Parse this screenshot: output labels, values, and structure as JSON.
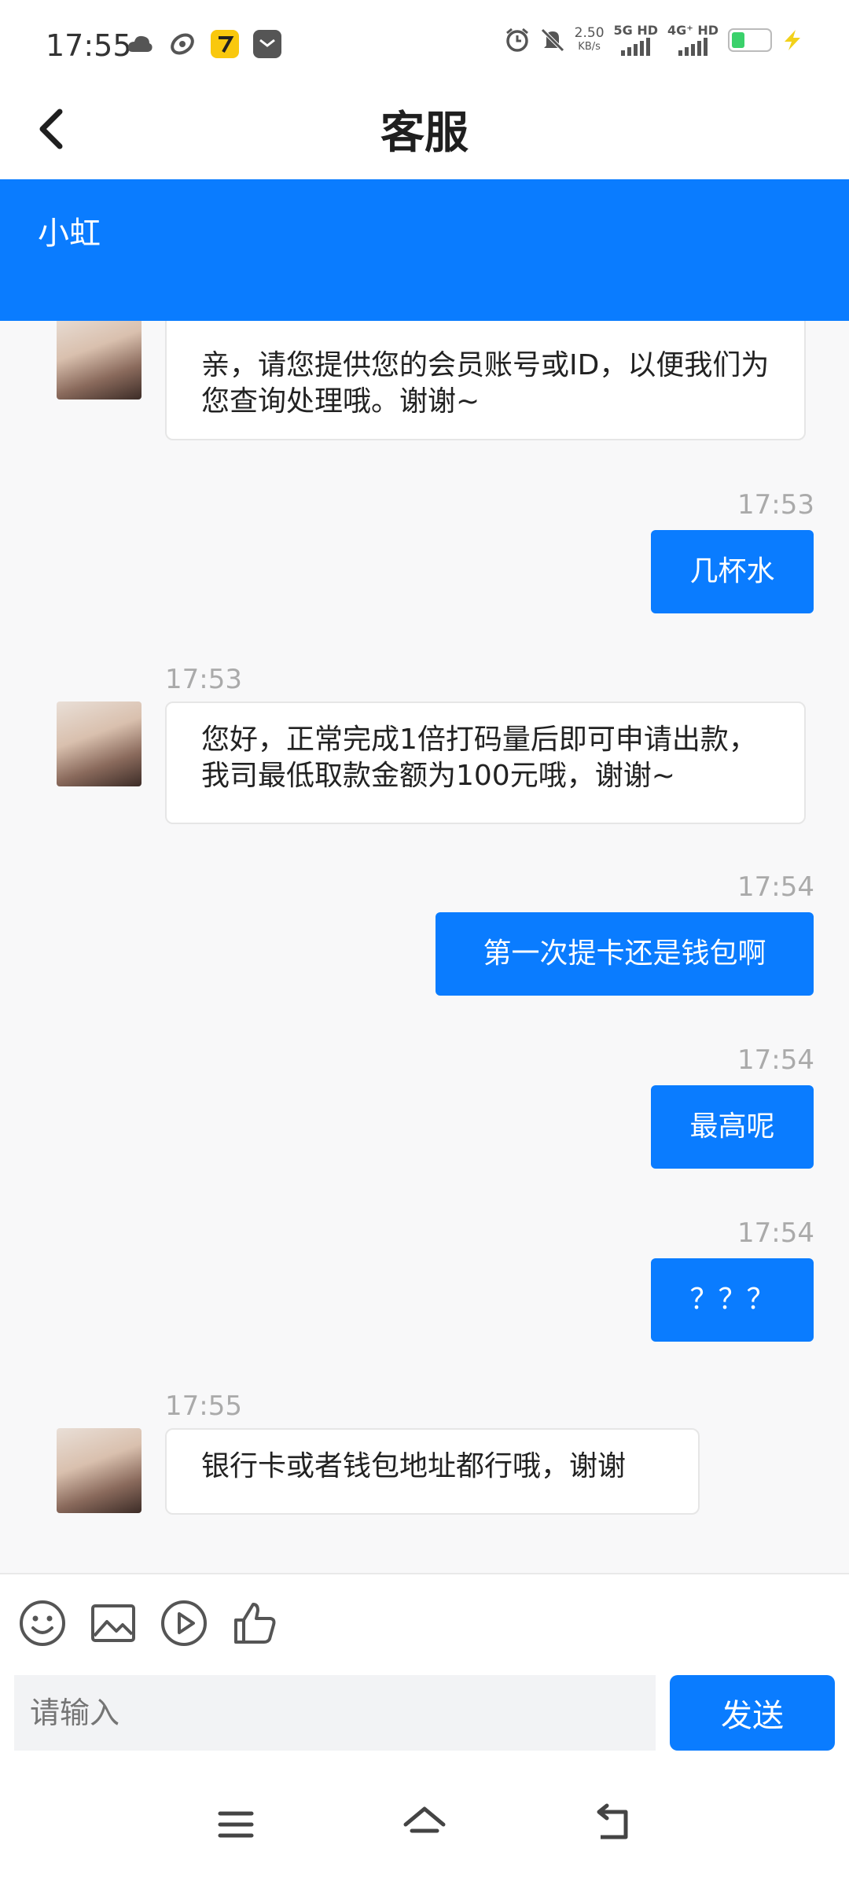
{
  "status_bar": {
    "time": "17:55",
    "speed_value": "2.50",
    "speed_unit": "KB/s",
    "sim1": "5G HD",
    "sim2": "4G⁺ HD",
    "left_icons": [
      "cloud-icon",
      "sync-icon",
      "app-7-icon",
      "mail-icon"
    ],
    "right_icons": [
      "alarm-icon",
      "mute-icon",
      "signal-icon",
      "battery-icon",
      "charging-icon"
    ]
  },
  "header": {
    "title": "客服",
    "back_icon": "chevron-left-icon"
  },
  "banner": {
    "agent_name": "小虹"
  },
  "messages": [
    {
      "side": "in",
      "time": "",
      "text": "亲，请您提供您的会员账号或ID，以便我们为您查询处理哦。谢谢~"
    },
    {
      "side": "out",
      "time": "17:53",
      "text": "几杯水"
    },
    {
      "side": "in",
      "time": "17:53",
      "text": "您好，正常完成1倍打码量后即可申请出款，我司最低取款金额为100元哦，谢谢~"
    },
    {
      "side": "out",
      "time": "17:54",
      "text": "第一次提卡还是钱包啊"
    },
    {
      "side": "out",
      "time": "17:54",
      "text": "最高呢"
    },
    {
      "side": "out",
      "time": "17:54",
      "text": "？？？"
    },
    {
      "side": "in",
      "time": "17:55",
      "text": "银行卡或者钱包地址都行哦，谢谢"
    }
  ],
  "toolbar": {
    "icons": [
      "emoji-icon",
      "image-icon",
      "video-icon",
      "thumbs-up-icon"
    ]
  },
  "input": {
    "placeholder": "请输入",
    "value": ""
  },
  "send_label": "发送",
  "colors": {
    "accent": "#0a7cff",
    "background": "#f8f8f9",
    "bubble_in": "#ffffff"
  }
}
